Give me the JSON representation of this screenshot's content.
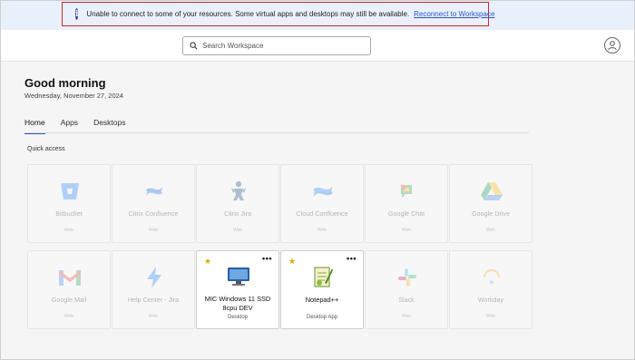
{
  "banner": {
    "message": "Unable to connect to some of your resources. Some virtual apps and desktops may still be available.",
    "link": "Reconnect to Workspace",
    "info_glyph": "i"
  },
  "header": {
    "search_placeholder": "Search Workspace"
  },
  "greeting": {
    "title": "Good morning",
    "date": "Wednesday, November 27, 2024"
  },
  "tabs": [
    "Home",
    "Apps",
    "Desktops"
  ],
  "active_tab": "Home",
  "quick_access_label": "Quick access",
  "tiles": [
    {
      "name": "Bitbucket",
      "type": "Web",
      "icon": "bitbucket-icon",
      "enabled": false,
      "favorite": false
    },
    {
      "name": "Citrix Confluence",
      "type": "Web",
      "icon": "confluence-icon",
      "enabled": false,
      "favorite": false
    },
    {
      "name": "Citrix Jira",
      "type": "Web",
      "icon": "jira-icon",
      "enabled": false,
      "favorite": false
    },
    {
      "name": "Cloud Confluence",
      "type": "Web",
      "icon": "confluence-icon",
      "enabled": false,
      "favorite": false
    },
    {
      "name": "Google Chat",
      "type": "Web",
      "icon": "google-chat-icon",
      "enabled": false,
      "favorite": false
    },
    {
      "name": "Google Drive",
      "type": "Web",
      "icon": "google-drive-icon",
      "enabled": false,
      "favorite": false
    },
    {
      "name": "Google Mail",
      "type": "Web",
      "icon": "gmail-icon",
      "enabled": false,
      "favorite": false
    },
    {
      "name": "Help Center - Jira",
      "type": "Web",
      "icon": "bolt-icon",
      "enabled": false,
      "favorite": false
    },
    {
      "name": "MIC Windows 11 SSD 8cpu DEV",
      "type": "Desktop",
      "icon": "desktop-icon",
      "enabled": true,
      "favorite": true
    },
    {
      "name": "Notepad++",
      "type": "Desktop App",
      "icon": "notepad-plus-plus-icon",
      "enabled": true,
      "favorite": true
    },
    {
      "name": "Slack",
      "type": "Web",
      "icon": "slack-icon",
      "enabled": false,
      "favorite": false
    },
    {
      "name": "Workday",
      "type": "Web",
      "icon": "workday-icon",
      "enabled": false,
      "favorite": false
    }
  ],
  "colors": {
    "accent": "#2b57c9",
    "error_border": "#d4242b",
    "banner_bg": "#e8f0fb",
    "star": "#e0a800"
  }
}
